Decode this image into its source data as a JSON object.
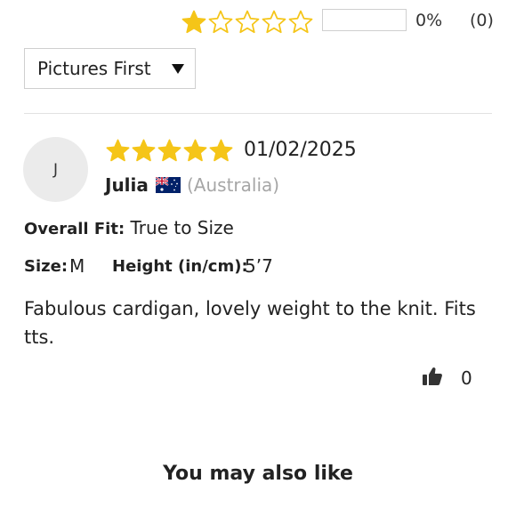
{
  "rating_summary": {
    "filled_stars": 1,
    "total_stars": 5,
    "bar_fill_percent": 0,
    "percent_label": "0%",
    "count_label": "(0)",
    "star_color": "#f5c518"
  },
  "sort": {
    "selected": "Pictures First",
    "icon": "caret-down-icon"
  },
  "review": {
    "avatar_initial": "J",
    "rating": 5,
    "date": "01/02/2025",
    "author": "Julia",
    "flag_icon": "australia-flag-icon",
    "country": "(Australia)",
    "overall_fit_label": "Overall Fit:",
    "overall_fit_value": "True to Size",
    "size_label": "Size:",
    "size_value": "M",
    "height_label": "Height (in/cm):",
    "height_value": "5’7",
    "text": "Fabulous cardigan, lovely weight to the knit. Fits tts.",
    "helpful_icon": "thumbs-up-icon",
    "helpful_count": "0"
  },
  "recommendations": {
    "heading": "You may also like"
  }
}
